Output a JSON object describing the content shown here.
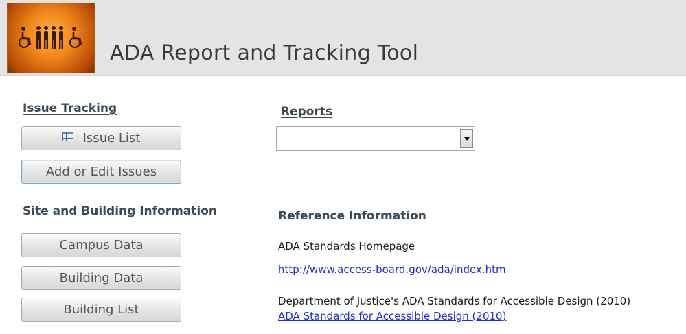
{
  "header": {
    "title": "ADA Report and Tracking Tool",
    "logo_icon": "accessibility-people-icon"
  },
  "issue_tracking": {
    "heading": "Issue Tracking",
    "issue_list_label": "Issue List",
    "add_edit_label": "Add or Edit Issues"
  },
  "site_building": {
    "heading": "Site and Building Information",
    "campus_label": "Campus Data",
    "building_label": "Building Data",
    "building_list_label": "Building List"
  },
  "reports": {
    "heading": "Reports",
    "selected": ""
  },
  "reference": {
    "heading": "Reference Information",
    "homepage_label": "ADA Standards Homepage",
    "homepage_link": "http://www.access-board.gov/ada/index.htm",
    "doj_label": "Department of Justice's ADA Standards for Accessible Design (2010)",
    "doj_link": "ADA Standards for Accessible Design (2010)"
  },
  "colors": {
    "header_bg": "#e4e4e4",
    "section_heading": "#3b4a55",
    "link": "#1b2fd6",
    "logo_orange": "#f0861a"
  }
}
